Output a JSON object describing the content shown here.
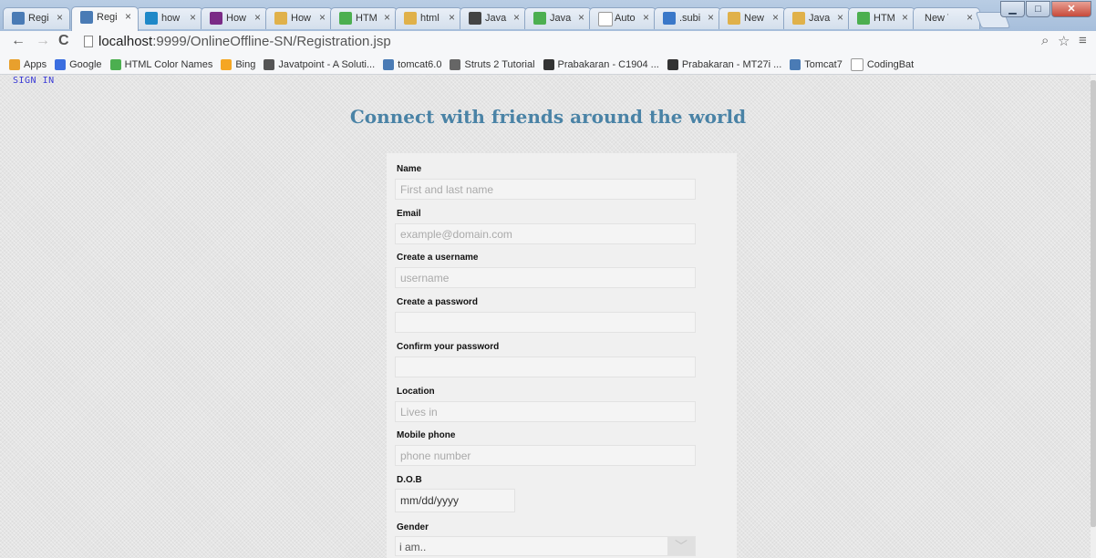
{
  "browser": {
    "tabs": [
      {
        "title": "Regi",
        "fav": "#4a7bb5"
      },
      {
        "title": "Regi",
        "fav": "#4a7bb5",
        "active": true
      },
      {
        "title": "how",
        "fav": "#1e88c8"
      },
      {
        "title": "How",
        "fav": "#7a2b86"
      },
      {
        "title": "How",
        "fav": "#e0b14a"
      },
      {
        "title": "HTM",
        "fav": "#4caf50"
      },
      {
        "title": "html",
        "fav": "#e0b14a"
      },
      {
        "title": "Java",
        "fav": "#444444"
      },
      {
        "title": "Java",
        "fav": "#4caf50"
      },
      {
        "title": "Auto",
        "fav": "#ffffff"
      },
      {
        "title": ".subi",
        "fav": "#3a78c9"
      },
      {
        "title": "New",
        "fav": "#e0b14a"
      },
      {
        "title": "Java",
        "fav": "#e0b14a"
      },
      {
        "title": "HTM",
        "fav": "#4caf50"
      },
      {
        "title": "New Tal",
        "fav": ""
      }
    ],
    "url_host": "localhost",
    "url_path": ":9999/OnlineOffline-SN/Registration.jsp",
    "bookmarks": [
      {
        "label": "Apps",
        "icon": "apps-icon",
        "color": "#e8a02d"
      },
      {
        "label": "Google",
        "icon": "google-icon",
        "color": "#3b6ee0"
      },
      {
        "label": "HTML Color Names",
        "icon": "w3schools-icon",
        "color": "#4caf50"
      },
      {
        "label": "Bing",
        "icon": "bing-icon",
        "color": "#f5a623"
      },
      {
        "label": "Javatpoint - A Soluti...",
        "icon": "javatpoint-icon",
        "color": "#555555"
      },
      {
        "label": "tomcat6.0",
        "icon": "tomcat-icon",
        "color": "#4a7bb5"
      },
      {
        "label": "Struts 2 Tutorial",
        "icon": "struts-icon",
        "color": "#666666"
      },
      {
        "label": "Prabakaran - C1904 ...",
        "icon": "wifi-icon",
        "color": "#333333"
      },
      {
        "label": "Prabakaran - MT27i ...",
        "icon": "wifi-icon",
        "color": "#333333"
      },
      {
        "label": "Tomcat7",
        "icon": "tomcat-icon",
        "color": "#4a7bb5"
      },
      {
        "label": "CodingBat",
        "icon": "page-icon",
        "color": "#ffffff"
      }
    ]
  },
  "page": {
    "signin": "SIGN IN",
    "headline": "Connect with friends around the world",
    "form": {
      "name": {
        "label": "Name",
        "placeholder": "First and last name"
      },
      "email": {
        "label": "Email",
        "placeholder": "example@domain.com"
      },
      "username": {
        "label": "Create a username",
        "placeholder": "username"
      },
      "password": {
        "label": "Create a password",
        "placeholder": ""
      },
      "confirm": {
        "label": "Confirm your password",
        "placeholder": ""
      },
      "location": {
        "label": "Location",
        "placeholder": "Lives in"
      },
      "mobile": {
        "label": "Mobile phone",
        "placeholder": "phone number"
      },
      "dob": {
        "label": "D.O.B",
        "value": "mm/dd/yyyy"
      },
      "gender": {
        "label": "Gender",
        "value": "i am.."
      }
    }
  }
}
